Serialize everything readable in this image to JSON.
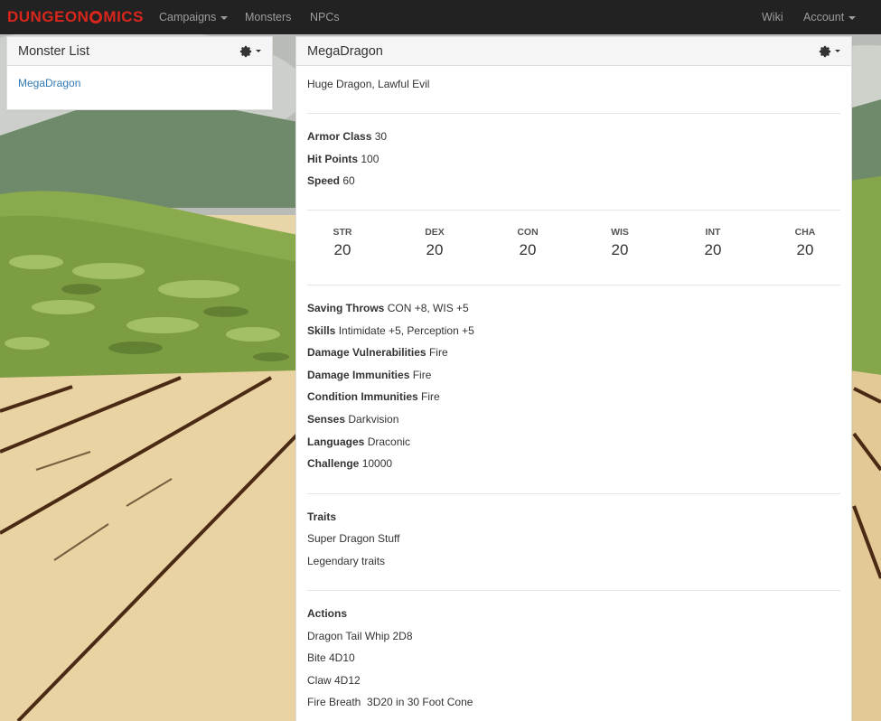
{
  "nav": {
    "brand_left": "DUNGEON",
    "brand_right": "MICS",
    "campaigns": "Campaigns",
    "monsters": "Monsters",
    "npcs": "NPCs",
    "wiki": "Wiki",
    "account": "Account"
  },
  "monster_list": {
    "title": "Monster List",
    "items": [
      "MegaDragon"
    ]
  },
  "monster": {
    "name": "MegaDragon",
    "type": "Huge Dragon, Lawful Evil",
    "armor_class_label": "Armor Class",
    "armor_class": "30",
    "hit_points_label": "Hit Points",
    "hit_points": "100",
    "speed_label": "Speed",
    "speed": "60",
    "abilities": [
      {
        "label": "STR",
        "value": "20"
      },
      {
        "label": "DEX",
        "value": "20"
      },
      {
        "label": "CON",
        "value": "20"
      },
      {
        "label": "WIS",
        "value": "20"
      },
      {
        "label": "INT",
        "value": "20"
      },
      {
        "label": "CHA",
        "value": "20"
      }
    ],
    "saving_throws_label": "Saving Throws",
    "saving_throws": "CON +8, WIS +5",
    "skills_label": "Skills",
    "skills": "Intimidate +5, Perception +5",
    "damage_vulnerabilities_label": "Damage Vulnerabilities",
    "damage_vulnerabilities": "Fire",
    "damage_immunities_label": "Damage Immunities",
    "damage_immunities": "Fire",
    "condition_immunities_label": "Condition Immunities",
    "condition_immunities": "Fire",
    "senses_label": "Senses",
    "senses": "Darkvision",
    "languages_label": "Languages",
    "languages": "Draconic",
    "challenge_label": "Challenge",
    "challenge": "10000",
    "traits_label": "Traits",
    "traits": [
      "Super Dragon Stuff",
      "Legendary traits"
    ],
    "actions_label": "Actions",
    "actions": [
      "Dragon Tail Whip 2D8",
      "Bite 4D10",
      "Claw 4D12",
      "Fire Breath  3D20 in 30 Foot Cone"
    ]
  },
  "colors": {
    "brand": "#d9261c",
    "navbar": "#222222",
    "link": "#337ab7"
  }
}
